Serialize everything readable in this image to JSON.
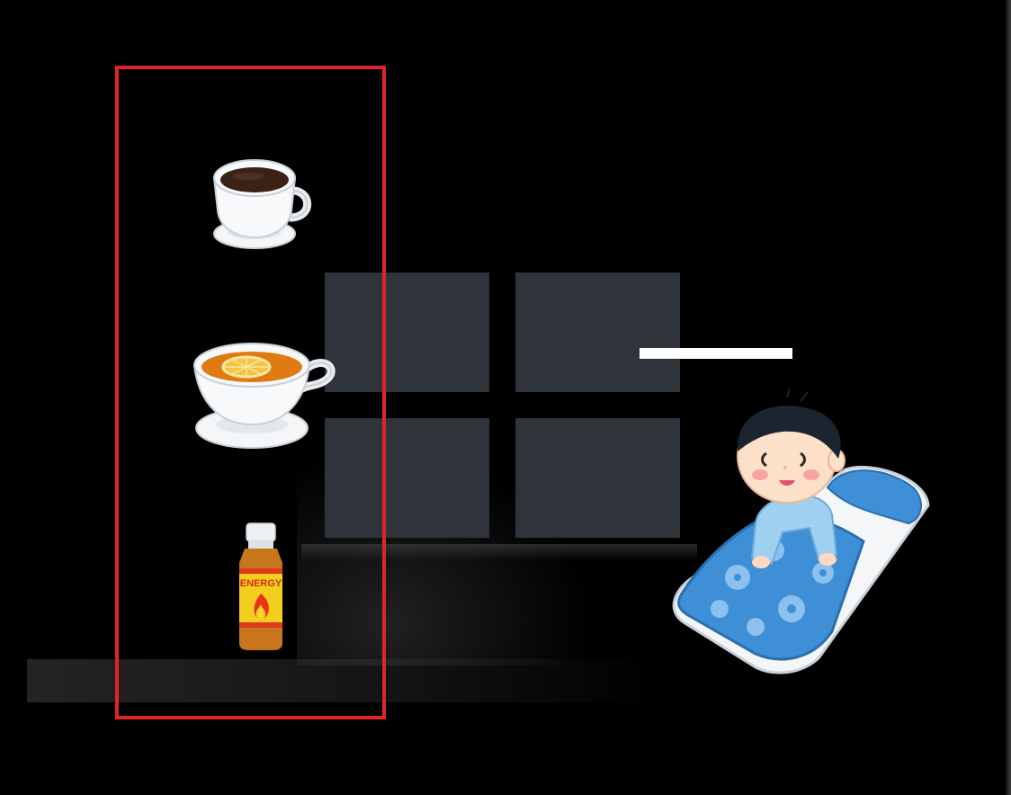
{
  "scene": {
    "highlight_color": "#e0242a",
    "window_pane_color": "#2e3439",
    "drinks": [
      {
        "icon": "coffee-cup-icon"
      },
      {
        "icon": "lemon-tea-cup-icon"
      },
      {
        "icon": "energy-drink-bottle-icon",
        "label": "ENERGY"
      }
    ],
    "sleeper": {
      "icon": "boy-in-bed-icon"
    }
  }
}
